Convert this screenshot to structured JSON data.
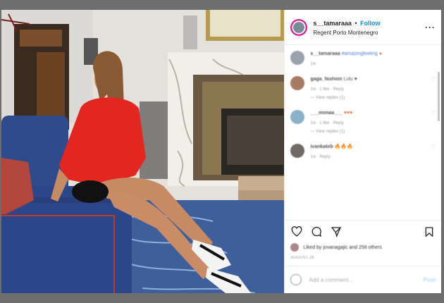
{
  "post": {
    "username": "s__tamaraaa",
    "separator": "•",
    "follow_label": "Follow",
    "location": "Regent Porto Montenegro",
    "more_icon": "more-horizontal-icon"
  },
  "comments": [
    {
      "user": "s__tamaraaa",
      "text": "#amazingfeeling",
      "meta": "1w",
      "replies": ""
    },
    {
      "user": "gaga_fashion",
      "text": "Lulu ♥",
      "meta": "1w · 1 like · Reply",
      "replies": "— View replies (1)"
    },
    {
      "user": "___mimaa___",
      "text": "♥♥♥",
      "meta": "1w · 1 like · Reply",
      "replies": "— View replies (1)"
    },
    {
      "user": "ivankateb",
      "text": "🔥🔥🔥",
      "meta": "1w · Reply",
      "replies": ""
    }
  ],
  "likes_text": "Liked by jovanagajic and 258 others",
  "date_text": "AUGUST 26",
  "add_comment_placeholder": "Add a comment...",
  "post_label": "Post"
}
